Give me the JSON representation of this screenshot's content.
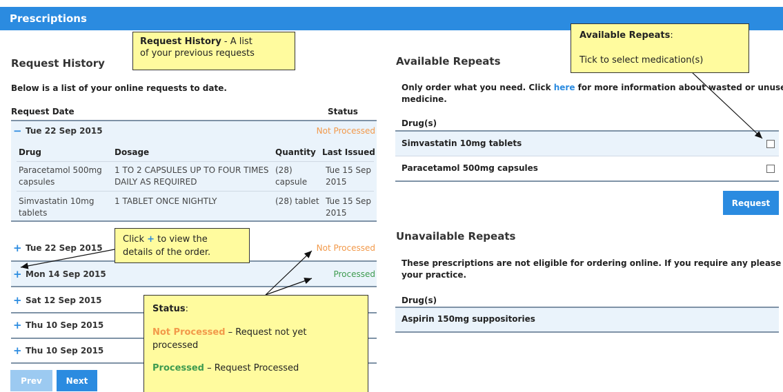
{
  "header": {
    "title": "Prescriptions"
  },
  "history": {
    "heading": "Request History",
    "intro": "Below is a list of your online requests to date.",
    "col_date": "Request Date",
    "col_status": "Status",
    "expanded": {
      "toggle": "−",
      "date": "Tue 22 Sep 2015",
      "status": "Not Processed",
      "cols": {
        "drug": "Drug",
        "dosage": "Dosage",
        "quantity": "Quantity",
        "last_issued": "Last Issued"
      },
      "rows": [
        {
          "drug_l1": "Paracetamol 500mg",
          "drug_l2": "capsules",
          "dosage_l1": "1 TO 2 CAPSULES UP TO FOUR TIMES",
          "dosage_l2": "DAILY AS REQUIRED",
          "qty_l1": "(28)",
          "qty_l2": "capsule",
          "last_l1": "Tue 15 Sep",
          "last_l2": "2015"
        },
        {
          "drug_l1": "Simvastatin 10mg",
          "drug_l2": "tablets",
          "dosage_l1": "1 TABLET ONCE NIGHTLY",
          "dosage_l2": "",
          "qty_l1": "(28) tablet",
          "qty_l2": "",
          "last_l1": "Tue 15 Sep",
          "last_l2": "2015"
        }
      ]
    },
    "orders": [
      {
        "toggle": "+",
        "date": "Tue 22 Sep 2015",
        "status": "Not Processed"
      },
      {
        "toggle": "+",
        "date": "Mon 14 Sep 2015",
        "status": "Processed"
      },
      {
        "toggle": "+",
        "date": "Sat 12 Sep 2015",
        "status": ""
      },
      {
        "toggle": "+",
        "date": "Thu 10 Sep 2015",
        "status": ""
      },
      {
        "toggle": "+",
        "date": "Thu 10 Sep 2015",
        "status": ""
      }
    ],
    "prev_label": "Prev",
    "next_label": "Next"
  },
  "repeats": {
    "heading": "Available Repeats",
    "info_l1_pre": "Only order what you need. Click ",
    "info_link": "here",
    "info_l1_post": " for more information about wasted or unused",
    "info_l2": "medicine.",
    "col_drug": "Drug(s)",
    "items": [
      {
        "name": "Simvastatin 10mg tablets",
        "checked": false
      },
      {
        "name": "Paracetamol 500mg capsules",
        "checked": false
      }
    ],
    "request_label": "Request"
  },
  "unavailable": {
    "heading": "Unavailable Repeats",
    "info_l1": "These prescriptions are not eligible for ordering online. If you require any please contact",
    "info_l2": "your practice.",
    "col_drug": "Drug(s)",
    "items": [
      {
        "name": "Aspirin 150mg suppositories"
      }
    ]
  },
  "callouts": {
    "history_title": "Request History",
    "history_text1": " - A list",
    "history_text2": "of your previous requests",
    "repeats_title": "Available Repeats",
    "repeats_colon": ":",
    "repeats_text": "Tick to select medication(s)",
    "click_pre": "Click ",
    "click_plus": "+",
    "click_post": " to view the",
    "click_line2": "details of the order.",
    "status_title": "Status",
    "status_colon": ":",
    "status_np": "Not Processed",
    "status_np_text": " – Request not yet",
    "status_np_line2": "processed",
    "status_p": "Processed",
    "status_p_text": " – Request Processed"
  },
  "colors": {
    "accent": "#2b8be0",
    "not_processed": "#f2994a",
    "processed": "#3e9b4f",
    "note_bg": "#fffb9e"
  }
}
